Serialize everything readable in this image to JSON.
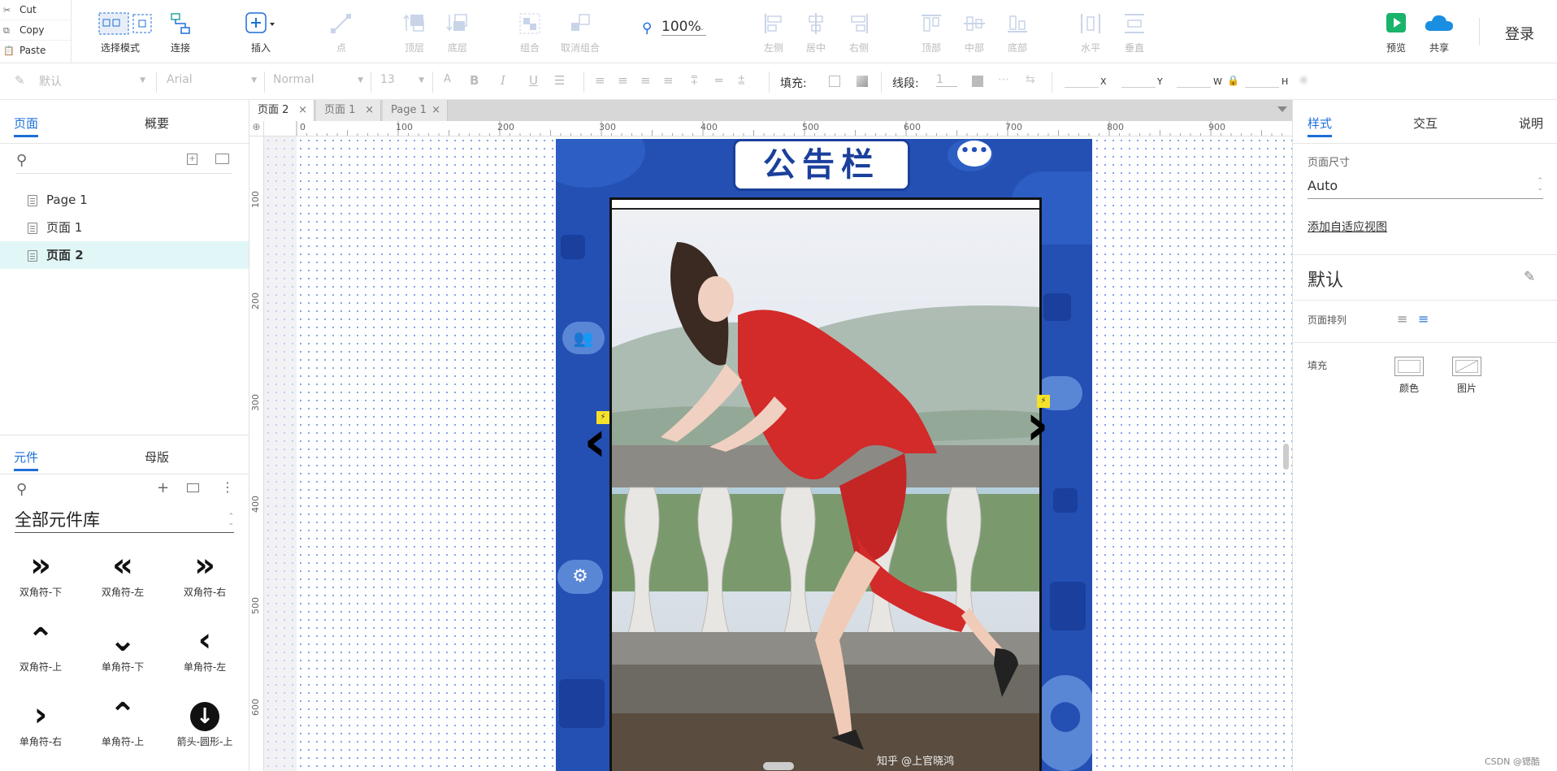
{
  "clipboard": {
    "cut": "Cut",
    "copy": "Copy",
    "paste": "Paste"
  },
  "toolbar": {
    "select_mode": "选择模式",
    "connect": "连接",
    "insert": "插入",
    "point": "点",
    "top_layer": "顶层",
    "bottom_layer": "底层",
    "group": "组合",
    "ungroup": "取消组合",
    "zoom": "100%",
    "align_left": "左侧",
    "align_center": "居中",
    "align_right": "右侧",
    "align_top": "顶部",
    "align_middle": "中部",
    "align_bottom": "底部",
    "dist_h": "水平",
    "dist_v": "垂直",
    "preview": "预览",
    "share": "共享",
    "login": "登录"
  },
  "format": {
    "style": "默认",
    "font": "Arial",
    "weight": "Normal",
    "size": "13",
    "fill_label": "填充:",
    "stroke_label": "线段:",
    "stroke_value": "1",
    "x_label": "X",
    "y_label": "Y",
    "w_label": "W",
    "h_label": "H"
  },
  "left_panel": {
    "tabs": [
      "页面",
      "概要"
    ],
    "pages": [
      "Page 1",
      "页面 1",
      "页面 2"
    ],
    "lib_tabs": [
      "元件",
      "母版"
    ],
    "library_name": "全部元件库",
    "items": [
      "双角符-下",
      "双角符-左",
      "双角符-右",
      "双角符-上",
      "单角符-下",
      "单角符-左",
      "单角符-右",
      "单角符-上",
      "箭头-圆形-上"
    ]
  },
  "doc_tabs": [
    "页面 2",
    "页面 1",
    "Page 1"
  ],
  "ruler": {
    "top": [
      "0",
      "100",
      "200",
      "300",
      "400",
      "500",
      "600",
      "700",
      "800",
      "900"
    ],
    "left": [
      "100",
      "200",
      "300",
      "400",
      "500",
      "600"
    ]
  },
  "canvas": {
    "board_title": "公告栏",
    "watermark": "知乎 @上官晓鸿"
  },
  "right_panel": {
    "tabs": [
      "样式",
      "交互",
      "说明"
    ],
    "page_size_label": "页面尺寸",
    "page_size_value": "Auto",
    "adaptive_link": "添加自适应视图",
    "default_style": "默认",
    "page_align_label": "页面排列",
    "fill_label": "填充",
    "fill_color": "颜色",
    "fill_image": "图片"
  },
  "footer_credit": "CSDN @锶酷",
  "colors": {
    "accent": "#1e6fd9",
    "board_blue": "#2450b4",
    "dress_red": "#d32a2a",
    "selected_page_bg": "#e1f7f7"
  }
}
